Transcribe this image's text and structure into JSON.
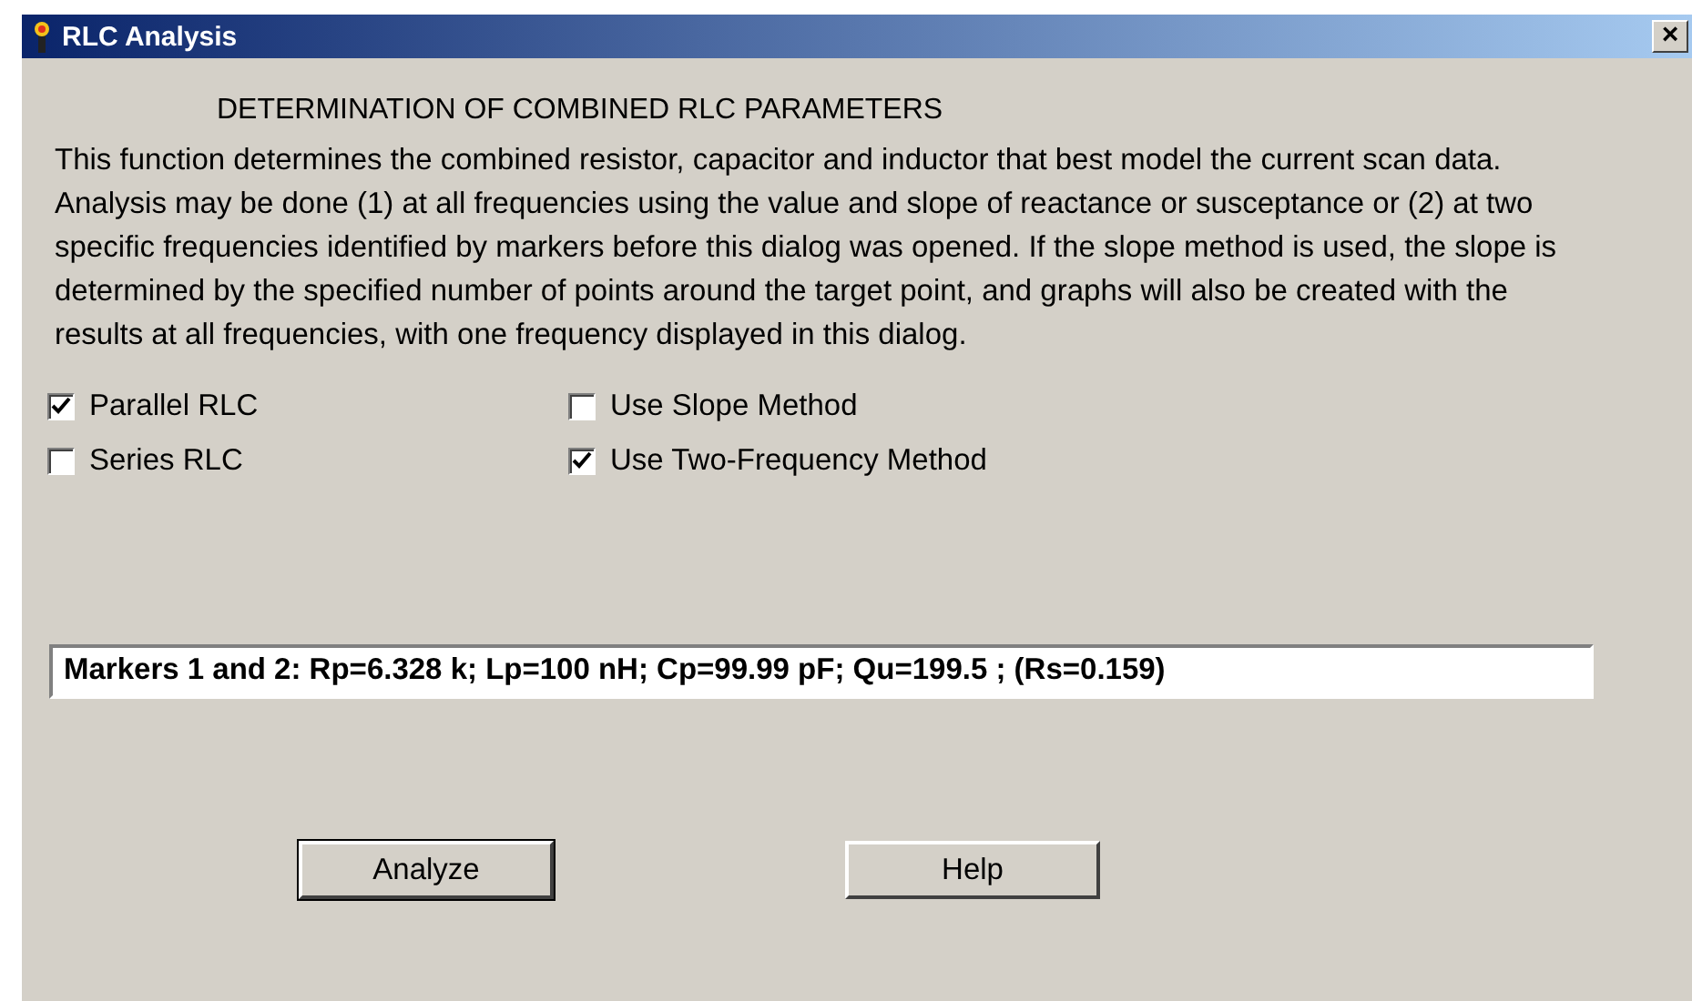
{
  "window": {
    "title": "RLC Analysis",
    "close": "×"
  },
  "heading": "DETERMINATION OF COMBINED RLC PARAMETERS",
  "description": "This function determines the combined resistor, capacitor and inductor that best model the current scan data. Analysis may be done (1) at all frequencies using the value and slope of reactance or susceptance or (2) at two specific frequencies identified by markers before this dialog was opened. If the slope method is used, the slope is determined by the specified number of points around the target point, and graphs will also be created with the results at all frequencies, with one frequency displayed in this dialog.",
  "options_left": [
    {
      "label": "Parallel RLC",
      "checked": true
    },
    {
      "label": "Series RLC",
      "checked": false
    }
  ],
  "options_right": [
    {
      "label": "Use Slope Method",
      "checked": false
    },
    {
      "label": "Use Two-Frequency Method",
      "checked": true
    }
  ],
  "result": "Markers 1 and 2: Rp=6.328 k; Lp=100 nH; Cp=99.99 pF; Qu=199.5 ; (Rs=0.159)",
  "buttons": [
    {
      "label": "Analyze",
      "default": true
    },
    {
      "label": "Help",
      "default": false
    }
  ]
}
